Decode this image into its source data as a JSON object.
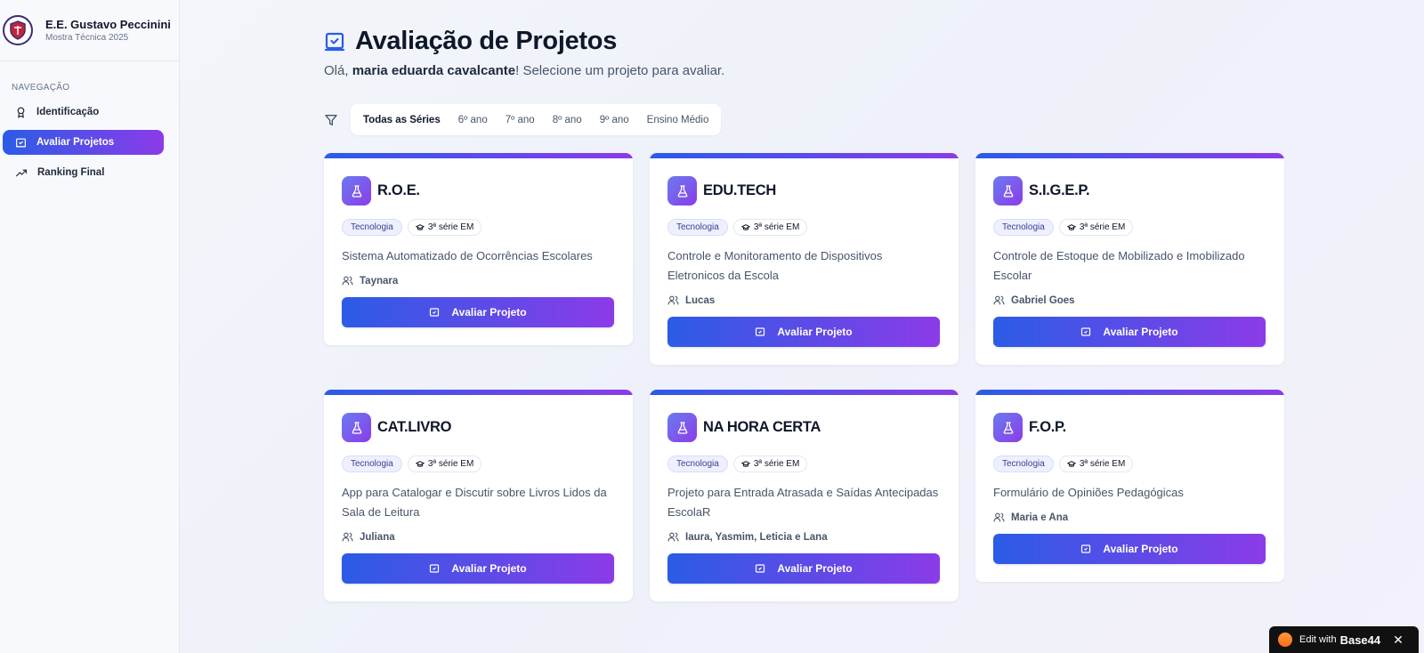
{
  "brand": {
    "title": "E.E. Gustavo Peccinini",
    "subtitle": "Mostra Técnica 2025"
  },
  "nav": {
    "heading": "NAVEGAÇÃO",
    "items": [
      {
        "label": "Identificação",
        "icon": "award-icon",
        "active": false
      },
      {
        "label": "Avaliar Projetos",
        "icon": "clipboard-check-icon",
        "active": true
      },
      {
        "label": "Ranking Final",
        "icon": "trending-up-icon",
        "active": false
      }
    ]
  },
  "header": {
    "title": "Avaliação de Projetos",
    "greeting_prefix": "Olá, ",
    "user_name": "maria eduarda cavalcante",
    "greeting_suffix": "! Selecione um projeto para avaliar."
  },
  "filters": {
    "tabs": [
      "Todas as Séries",
      "6º ano",
      "7º ano",
      "8º ano",
      "9º ano",
      "Ensino Médio"
    ],
    "active": "Todas as Séries"
  },
  "projects": [
    {
      "title": "R.O.E.",
      "category": "Tecnologia",
      "grade": "3ª série EM",
      "description": "Sistema Automatizado de Ocorrências Escolares",
      "team": "Taynara",
      "button": "Avaliar Projeto"
    },
    {
      "title": "EDU.TECH",
      "category": "Tecnologia",
      "grade": "3ª série EM",
      "description": "Controle e Monitoramento de Dispositivos Eletronicos da Escola",
      "team": "Lucas",
      "button": "Avaliar Projeto"
    },
    {
      "title": "S.I.G.E.P.",
      "category": "Tecnologia",
      "grade": "3ª série EM",
      "description": "Controle de Estoque de Mobilizado e Imobilizado Escolar",
      "team": "Gabriel Goes",
      "button": "Avaliar Projeto"
    },
    {
      "title": "CAT.LIVRO",
      "category": "Tecnologia",
      "grade": "3ª série EM",
      "description": "App para Catalogar e Discutir sobre Livros Lidos da Sala de Leitura",
      "team": "Juliana",
      "button": "Avaliar Projeto"
    },
    {
      "title": "NA HORA CERTA",
      "category": "Tecnologia",
      "grade": "3ª série EM",
      "description": "Projeto para Entrada Atrasada e Saídas Antecipadas EscolaR",
      "team": "Iaura, Yasmim, Leticia e Lana",
      "button": "Avaliar Projeto"
    },
    {
      "title": "F.O.P.",
      "category": "Tecnologia",
      "grade": "3ª série EM",
      "description": "Formulário de Opiniões Pedagógicas",
      "team": "Maria e Ana",
      "button": "Avaliar Projeto"
    }
  ],
  "edit_badge": {
    "text": "Edit with",
    "brand": "Base44",
    "close": "✕"
  },
  "colors": {
    "accent_start": "#2b5ce6",
    "accent_end": "#8b3be8"
  }
}
